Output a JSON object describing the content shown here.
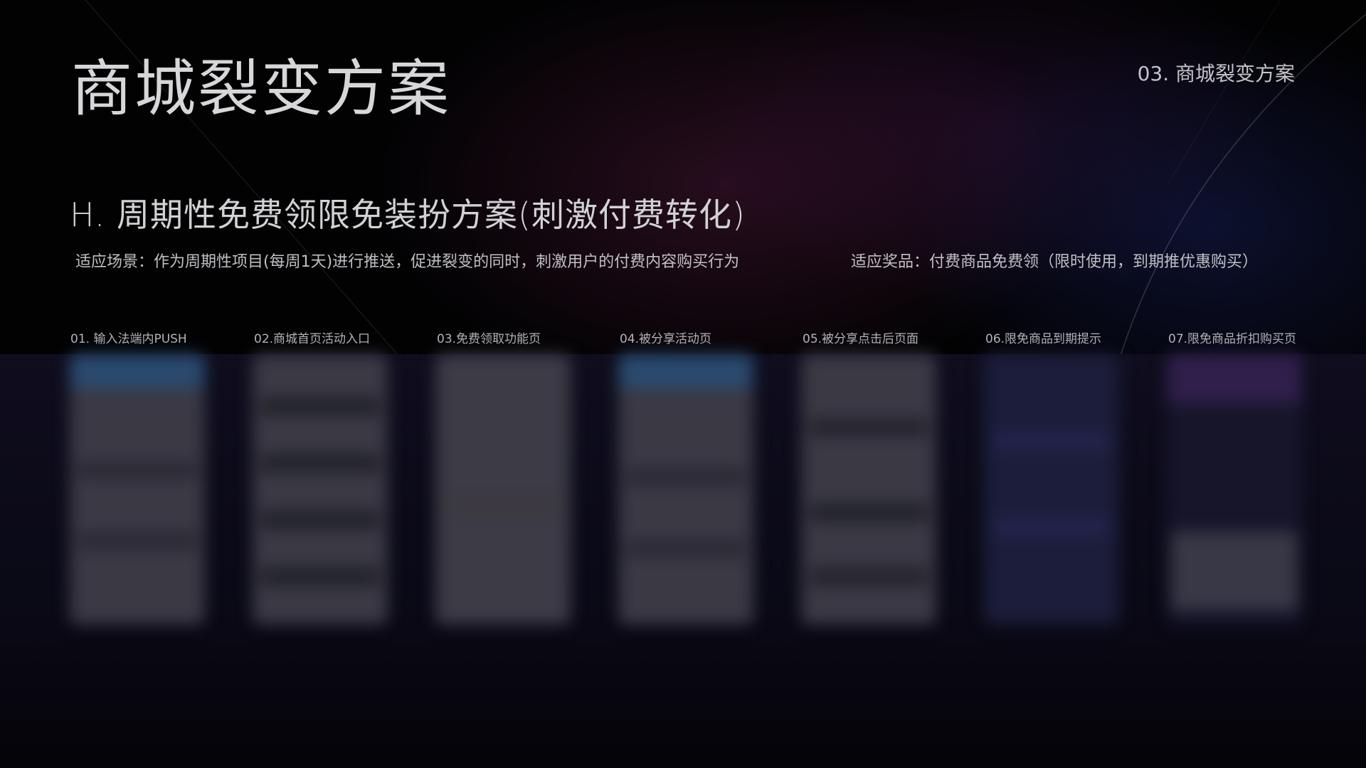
{
  "slide": {
    "main_title": "商城裂变方案",
    "section_label": "03. 商城裂变方案",
    "subtitle": "H. 周期性免费领限免装扮方案(刺激付费转化)",
    "scene_text": "适应场景：作为周期性项目(每周1天)进行推送，促进裂变的同时，刺激用户的付费内容购买行为",
    "prize_text": "适应奖品：付费商品免费领（限时使用，到期推优惠购买）"
  },
  "steps": [
    {
      "label": "01. 输入法端内PUSH"
    },
    {
      "label": "02.商城首页活动入口"
    },
    {
      "label": "03.免费领取功能页"
    },
    {
      "label": "04.被分享活动页"
    },
    {
      "label": "05.被分享点击后页面"
    },
    {
      "label": "06.限免商品到期提示"
    },
    {
      "label": "07.限免商品折扣购买页"
    }
  ],
  "colors": {
    "background": "#020203",
    "panel": "#0f0d1e",
    "phone_gray": "#3a3944",
    "phone_accent_blue": "#2a4a6e",
    "phone_dark_blue": "#1b1d3a",
    "phone_purple": "#2f1f4a"
  }
}
